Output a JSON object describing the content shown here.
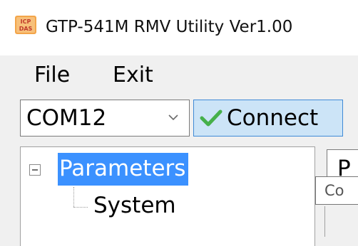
{
  "window": {
    "title": "GTP-541M RMV Utility Ver1.00",
    "icon": "icp-das-app-icon",
    "icon_text": "ICP DAS"
  },
  "menu": {
    "items": [
      {
        "label": "File"
      },
      {
        "label": "Exit"
      }
    ]
  },
  "toolbar": {
    "port_select": {
      "value": "COM12",
      "icon": "chevron-down-icon"
    },
    "connect_button": {
      "label": "Connect",
      "icon": "check-icon",
      "icon_color": "#46b04a"
    }
  },
  "tree": {
    "nodes": [
      {
        "label": "Parameters",
        "selected": true,
        "expanded": true,
        "expander_icon": "collapse-minus-icon",
        "children": [
          {
            "label": "System"
          }
        ]
      }
    ]
  },
  "right_panel": {
    "tab_label": "P",
    "tooltip_text": "Co"
  },
  "colors": {
    "selection": "#3b91ff",
    "button_hover": "#cce4f7",
    "button_border": "#3f8ad6"
  }
}
